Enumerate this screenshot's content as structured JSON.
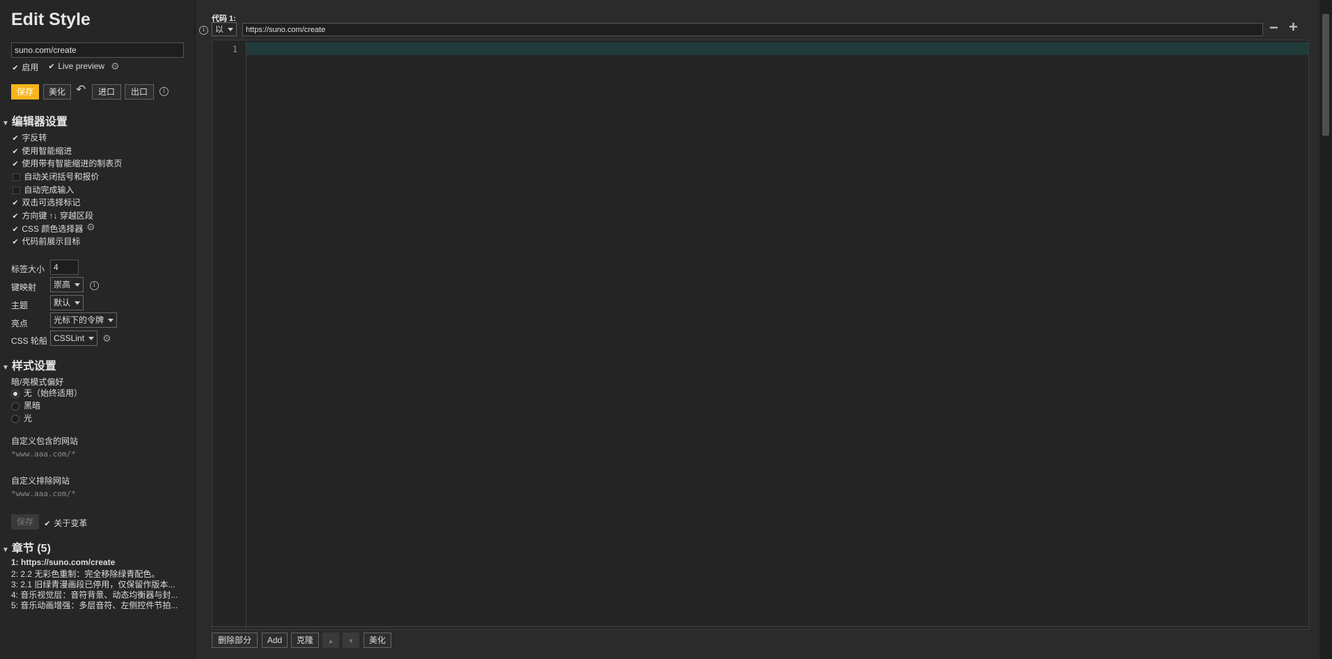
{
  "app": {
    "title": "Edit Style"
  },
  "style_name": "suno.com/create",
  "toggles": {
    "enable": "启用",
    "live_preview": "Live preview"
  },
  "actions": {
    "save": "保存",
    "beautify": "美化",
    "import": "进口",
    "export": "出口"
  },
  "editor_settings": {
    "heading": "编辑器设置",
    "options": [
      {
        "label": "字反转",
        "checked": true
      },
      {
        "label": "使用智能缩进",
        "checked": true
      },
      {
        "label": "使用带有智能缩进的制表页",
        "checked": true
      },
      {
        "label": "自动关闭括号和报价",
        "checked": false
      },
      {
        "label": "自动完成输入",
        "checked": false
      },
      {
        "label": "双击可选择标记",
        "checked": true
      },
      {
        "label": "方向键 ↑↓ 穿越区段",
        "checked": true
      },
      {
        "label": "CSS 颜色选择器",
        "checked": true
      },
      {
        "label": "代码前展示目标",
        "checked": true
      }
    ],
    "tab_size_label": "标签大小",
    "tab_size_value": "4",
    "keymap_label": "键映射",
    "keymap_value": "崇高",
    "theme_label": "主题",
    "theme_value": "默认",
    "highlight_label": "亮点",
    "highlight_value": "光标下的令牌",
    "lint_label": "CSS 轮船",
    "lint_value": "CSSLint"
  },
  "style_settings": {
    "heading": "样式设置",
    "scheme_label": "暗/亮模式偏好",
    "scheme_options": [
      {
        "label": "无（始终适用）",
        "selected": true
      },
      {
        "label": "黑暗",
        "selected": false
      },
      {
        "label": "光",
        "selected": false
      }
    ],
    "include_label": "自定义包含的网站",
    "include_placeholder": "*www.aaa.com/*",
    "exclude_label": "自定义排除网站",
    "exclude_placeholder": "*www.aaa.com/*",
    "save": "保存",
    "about_changes": "关于变革"
  },
  "sections": {
    "heading": "章节 (5)",
    "items": [
      "1: https://suno.com/create",
      "2: 2.2 无彩色重制：完全移除绿青配色。",
      "3: 2.1 旧绿青漫画段已停用，仅保留作版本...",
      "4: 音乐视觉层：音符背景、动态均衡器与封...",
      "5: 音乐动画增强：多层音符、左侧控件节拍..."
    ]
  },
  "code": {
    "label": "代码 1:",
    "applies_to_type": "以",
    "applies_to_value": "https://suno.com/create",
    "line_number": "1"
  },
  "bottom_actions": {
    "remove": "删除部分",
    "add": "Add",
    "clone": "克隆",
    "beautify": "美化"
  }
}
